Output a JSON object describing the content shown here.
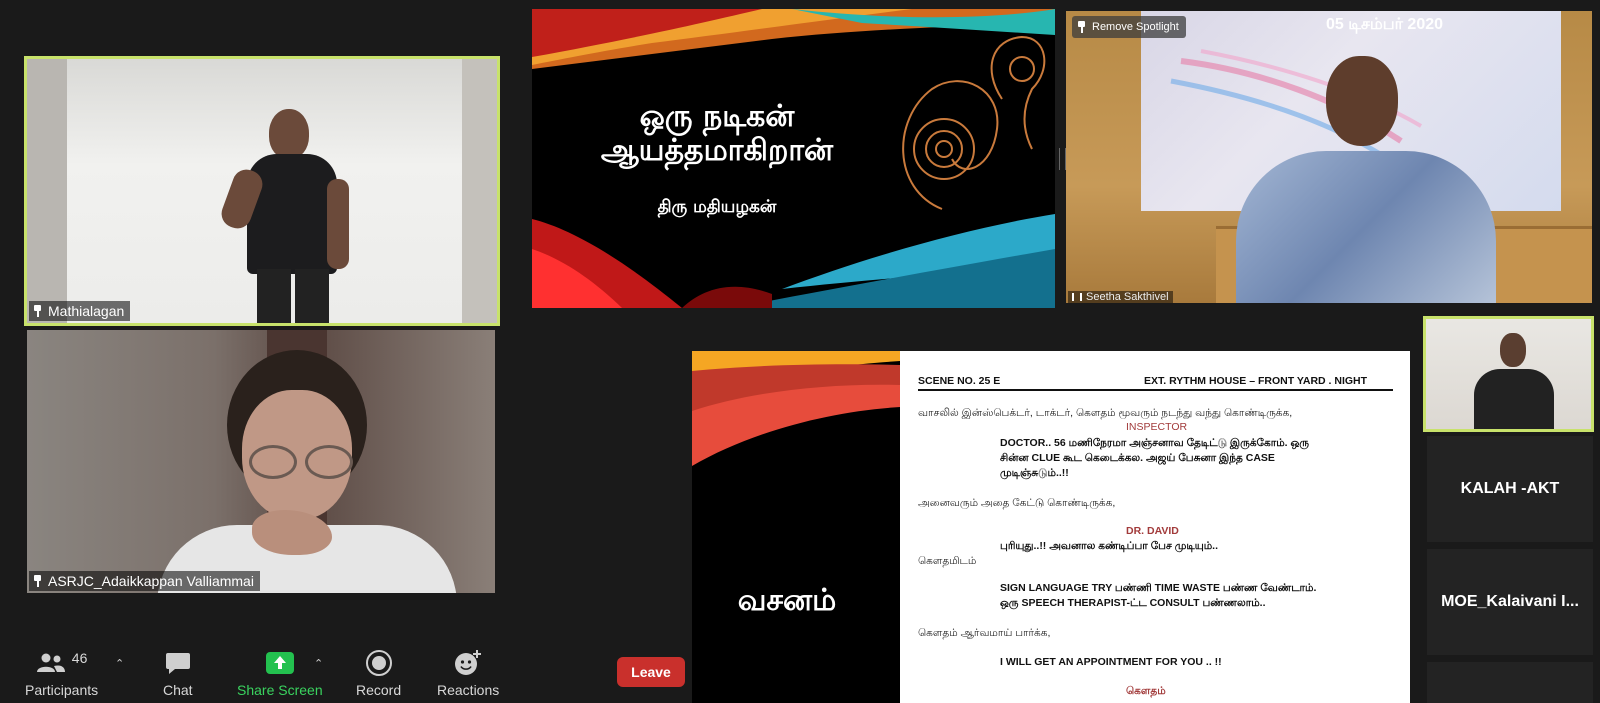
{
  "participants_video": [
    {
      "name": "Mathialagan"
    },
    {
      "name": "ASRJC_Adaikkappan Valliammai"
    },
    {
      "name": "Seetha Sakthivel"
    }
  ],
  "spotlight_button": {
    "label": "Remove Spotlight"
  },
  "video_overlay_date": "05 டிசம்பர் 2020",
  "title_slide": {
    "line1": "ஒரு நடிகன்",
    "line2": "ஆயத்தமாகிறான்",
    "author": "திரு மதியழகன்"
  },
  "script_slide": {
    "side_title": "வசனம்",
    "scene_no": "SCENE NO. 25 E",
    "scene_heading": "EXT. RYTHM HOUSE – FRONT YARD . NIGHT",
    "lines": [
      "வாசலில் இன்ஸ்பெக்டர், டாக்டர், கௌதம் மூவரும் நடந்து வந்து கொண்டிருக்க,",
      "INSPECTOR",
      "DOCTOR.. 56 மணிநேரமா அஞ்சனாவ தேடிட்டு இருக்கோம். ஒரு",
      "சின்ன CLUE கூட கெடைக்கல. அஜய் பேசுனா இந்த CASE",
      "முடிஞ்சுடும்..!!",
      "அனைவரும் அதை கேட்டு கொண்டிருக்க,",
      "DR. DAVID",
      "புரியுது..!! அவனால கண்டிப்பா பேச முடியும்..",
      "கௌதமிடம்",
      "SIGN LANGUAGE TRY பண்ணி TIME WASTE பண்ண வேண்டாம்.",
      "ஒரு SPEECH THERAPIST-ட்ட CONSULT பண்ணலாம்..",
      "கௌதம் ஆர்வமாய் பார்க்க,",
      "I WILL GET AN APPOINTMENT FOR YOU .. !!",
      "கௌதம்"
    ]
  },
  "side_participants": [
    {
      "name": "KALAH -AKT"
    },
    {
      "name": "MOE_Kalaivani  I..."
    }
  ],
  "toolbar": {
    "participants_label": "Participants",
    "participants_count": "46",
    "chat_label": "Chat",
    "share_label": "Share Screen",
    "record_label": "Record",
    "reactions_label": "Reactions",
    "leave_label": "Leave"
  },
  "colors": {
    "spotlight_border": "#c8e26b",
    "share_green": "#23c14f",
    "leave_red": "#c9302c"
  }
}
